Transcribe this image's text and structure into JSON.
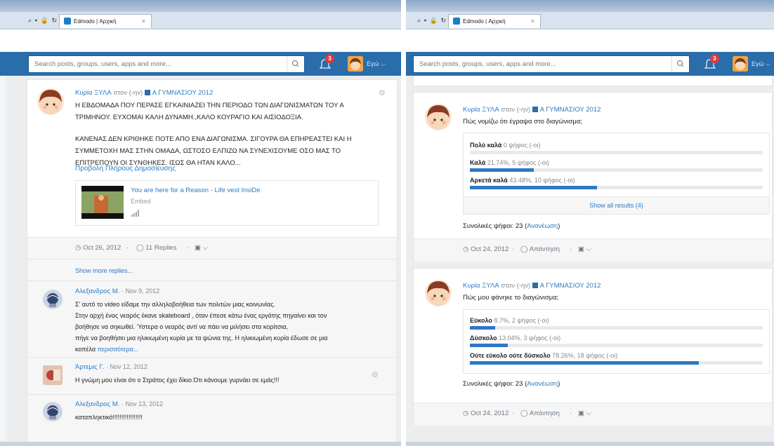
{
  "browser": {
    "tab_title": "Edmodo | Αρχική",
    "address_controls": "⌕ ▾ 🔒 ↻",
    "tab_close": "×"
  },
  "header": {
    "search_placeholder": "Search posts, groups, users, apps and more...",
    "notification_count": "3",
    "user_label": "Εγώ ⌵"
  },
  "left": {
    "post": {
      "author": "Κυρία ΞΥΛΑ",
      "to_text": "στον (-ην)",
      "group": "Α ΓΥΜΝΑΣΙΟΥ 2012",
      "text": [
        "Η ΕΒΔΟΜΑΔΑ ΠΟΥ ΠΕΡΑΣΕ ΕΓΚΑΙΝΙΑΖΕΙ ΤΗΝ ΠΕΡΙΟΔΟ ΤΩΝ ΔΙΑΓΩΝΙΣΜΑΤΩΝ ΤΟΥ Α",
        "ΤΡΙΜΗΝΟΥ. ΕΥΧΟΜΑΙ ΚΑΛΗ ΔΥΝΑΜΗ.,ΚΑΛΟ ΚΟΥΡΑΓΙΟ ΚΑΙ ΑΙΣΙΟΔΟΞΙΑ.",
        "",
        "ΚΑΝΕΝΑΣ ΔΕΝ ΚΡΙΘΗΚΕ ΠΟΤΕ ΑΠΟ ΕΝΑ ΔΙΑΓΩΝΙΣΜΑ. ΣΙΓΟΥΡΑ ΘΑ ΕΠΗΡΕΑΣΤΕΙ ΚΑΙ Η",
        "ΣΥΜΜΕΤΟΧΗ ΜΑΣ ΣΤΗΝ ΟΜΑΔΑ, ΩΣΤΟΣΟ ΕΛΠΙΖΩ ΝΑ ΣΥΝΕΧΙΣΟΥΜΕ ΟΣΟ ΜΑΣ ΤΟ",
        "ΕΠΙΤΡΕΠΟΥΝ ΟΙ ΣΥΝΘΗΚΕΣ. ΙΣΩΣ ΘΑ ΗΤΑΝ ΚΑΛΟ..."
      ],
      "full_post_link": "Προβολή Πλήρους Δημοσίευσης",
      "embed_title": "You are here for a Reason - Life vest InsiDe",
      "embed_type": "Embed",
      "date": "Oct 26, 2012",
      "replies": "11 Replies",
      "sep": "·"
    },
    "show_more": "Show more replies...",
    "replies": [
      {
        "author": "Αλεξανδρος Μ.",
        "date": "· Nov 9, 2012",
        "lines": [
          "Σ' αυτό το video είδαμε την αλληλοβοήθεια των πολιτών μιας κοινωνίας.",
          "Στην αρχή ένας νεαρός έκανε skateboard , όταν έπεσε κάτω ένας εργάτης πηγαίνει και τον",
          "βοήθησε να σηκωθεί. Ύστερα ο νεαρός αντί να πάει να μιλήσει στα κορίτσια,",
          "πήγε να βοηθήσει μια ηλικιωμένη κυρία με τα ψώνια της. Η ηλικιωμένη κυρία έδωσε σε μια"
        ],
        "last_line": "κοπέλα",
        "more": "περισσότερα..."
      },
      {
        "author": "Άρτεμις Γ.",
        "date": "· Nov 12, 2012",
        "lines": [
          "Η γνώμη μου είναι ότι ο Στράτος έχει δίκιο.Ότι κάνουμε γυρνάει σε εμάς!!!"
        ]
      },
      {
        "author": "Αλεξανδρος Μ.",
        "date": "· Nov 13, 2012",
        "lines": [
          "καταπληκτικό!!!!!!!!!!!!!!!!!"
        ]
      }
    ]
  },
  "right": {
    "polls": [
      {
        "author": "Κυρία ΞΥΛΑ",
        "to_text": "στον (-ην)",
        "group": "Α ΓΥΜΝΑΣΙΟΥ 2012",
        "question": "Πώς νομίζω ότι έγραψα στο διαγώνισμα;",
        "options": [
          {
            "label": "Πολύ καλά",
            "detail": "0 ψήφος (-οι)",
            "fraction": 0.0
          },
          {
            "label": "Καλά",
            "detail": "21.74%, 5 ψήφος (-οι)",
            "fraction": 0.2174
          },
          {
            "label": "Αρκετά καλά",
            "detail": "43.48%, 10 ψήφος (-οι)",
            "fraction": 0.4348
          }
        ],
        "show_all": "Show all results (4)",
        "total_label": "Συνολικές ψήφοι: 23 (",
        "refresh": "Ανανέωση",
        "total_close": ")",
        "date": "Oct 24, 2012",
        "reply": "Απάντηση"
      },
      {
        "author": "Κυρία ΞΥΛΑ",
        "to_text": "στον (-ην)",
        "group": "Α ΓΥΜΝΑΣΙΟΥ 2012",
        "question": "Πώς μου φάνηκε το διαγώνισμα;",
        "options": [
          {
            "label": "Εύκολο",
            "detail": "8.7%, 2 ψήφος (-οι)",
            "fraction": 0.087
          },
          {
            "label": "Δύσκολο",
            "detail": "13.04%, 3 ψήφος (-οι)",
            "fraction": 0.1304
          },
          {
            "label": "Ούτε εύκολο ούτε δύσκολο",
            "detail": "78.26%, 18 ψήφος (-οι)",
            "fraction": 0.7826
          }
        ],
        "total_label": "Συνολικές ψήφοι: 23 (",
        "refresh": "Ανανέωση",
        "total_close": ")",
        "date": "Oct 24, 2012",
        "reply": "Απάντηση"
      }
    ]
  },
  "colors": {
    "header_blue": "#2a6dab",
    "link_blue": "#2a7bc4",
    "bar_blue": "#2f77c5",
    "badge_red": "#e0393e"
  }
}
